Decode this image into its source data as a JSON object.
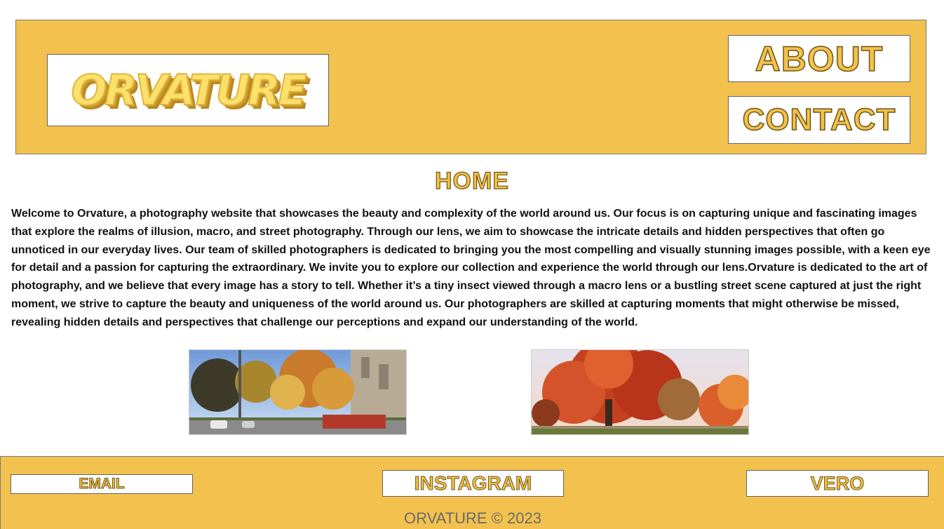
{
  "header": {
    "logo_text": "ORVATURE",
    "nav": {
      "about": "ABOUT",
      "contact": "CONTACT"
    }
  },
  "main": {
    "title": "HOME",
    "intro": "Welcome to Orvature, a photography website that showcases the beauty and complexity of the world around us. Our focus is on capturing unique and fascinating images that explore the realms of illusion, macro, and street photography. Through our lens, we aim to showcase the intricate details and hidden perspectives that often go unnoticed in our everyday lives. Our team of skilled photographers is dedicated to bringing you the most compelling and visually stunning images possible, with a keen eye for detail and a passion for capturing the extraordinary. We invite you to explore our collection and experience the world through our lens.Orvature is dedicated to the art of photography, and we believe that every image has a story to tell. Whether it’s a tiny insect viewed through a macro lens or a bustling street scene captured at just the right moment, we strive to capture the beauty and uniqueness of the world around us. Our photographers are skilled at capturing moments that might otherwise be missed, revealing hidden details and perspectives that challenge our perceptions and expand our understanding of the world.",
    "photos": [
      "autumn-street-photo",
      "red-maple-tree-photo"
    ]
  },
  "footer": {
    "email": "EMAIL",
    "instagram": "INSTAGRAM",
    "vero": "VERO",
    "copyright": "ORVATURE © 2023"
  },
  "colors": {
    "accent": "#f2c14e",
    "text_outline": "#6e5510",
    "body_text": "#111111",
    "copyright_text": "#6b6b6b"
  }
}
